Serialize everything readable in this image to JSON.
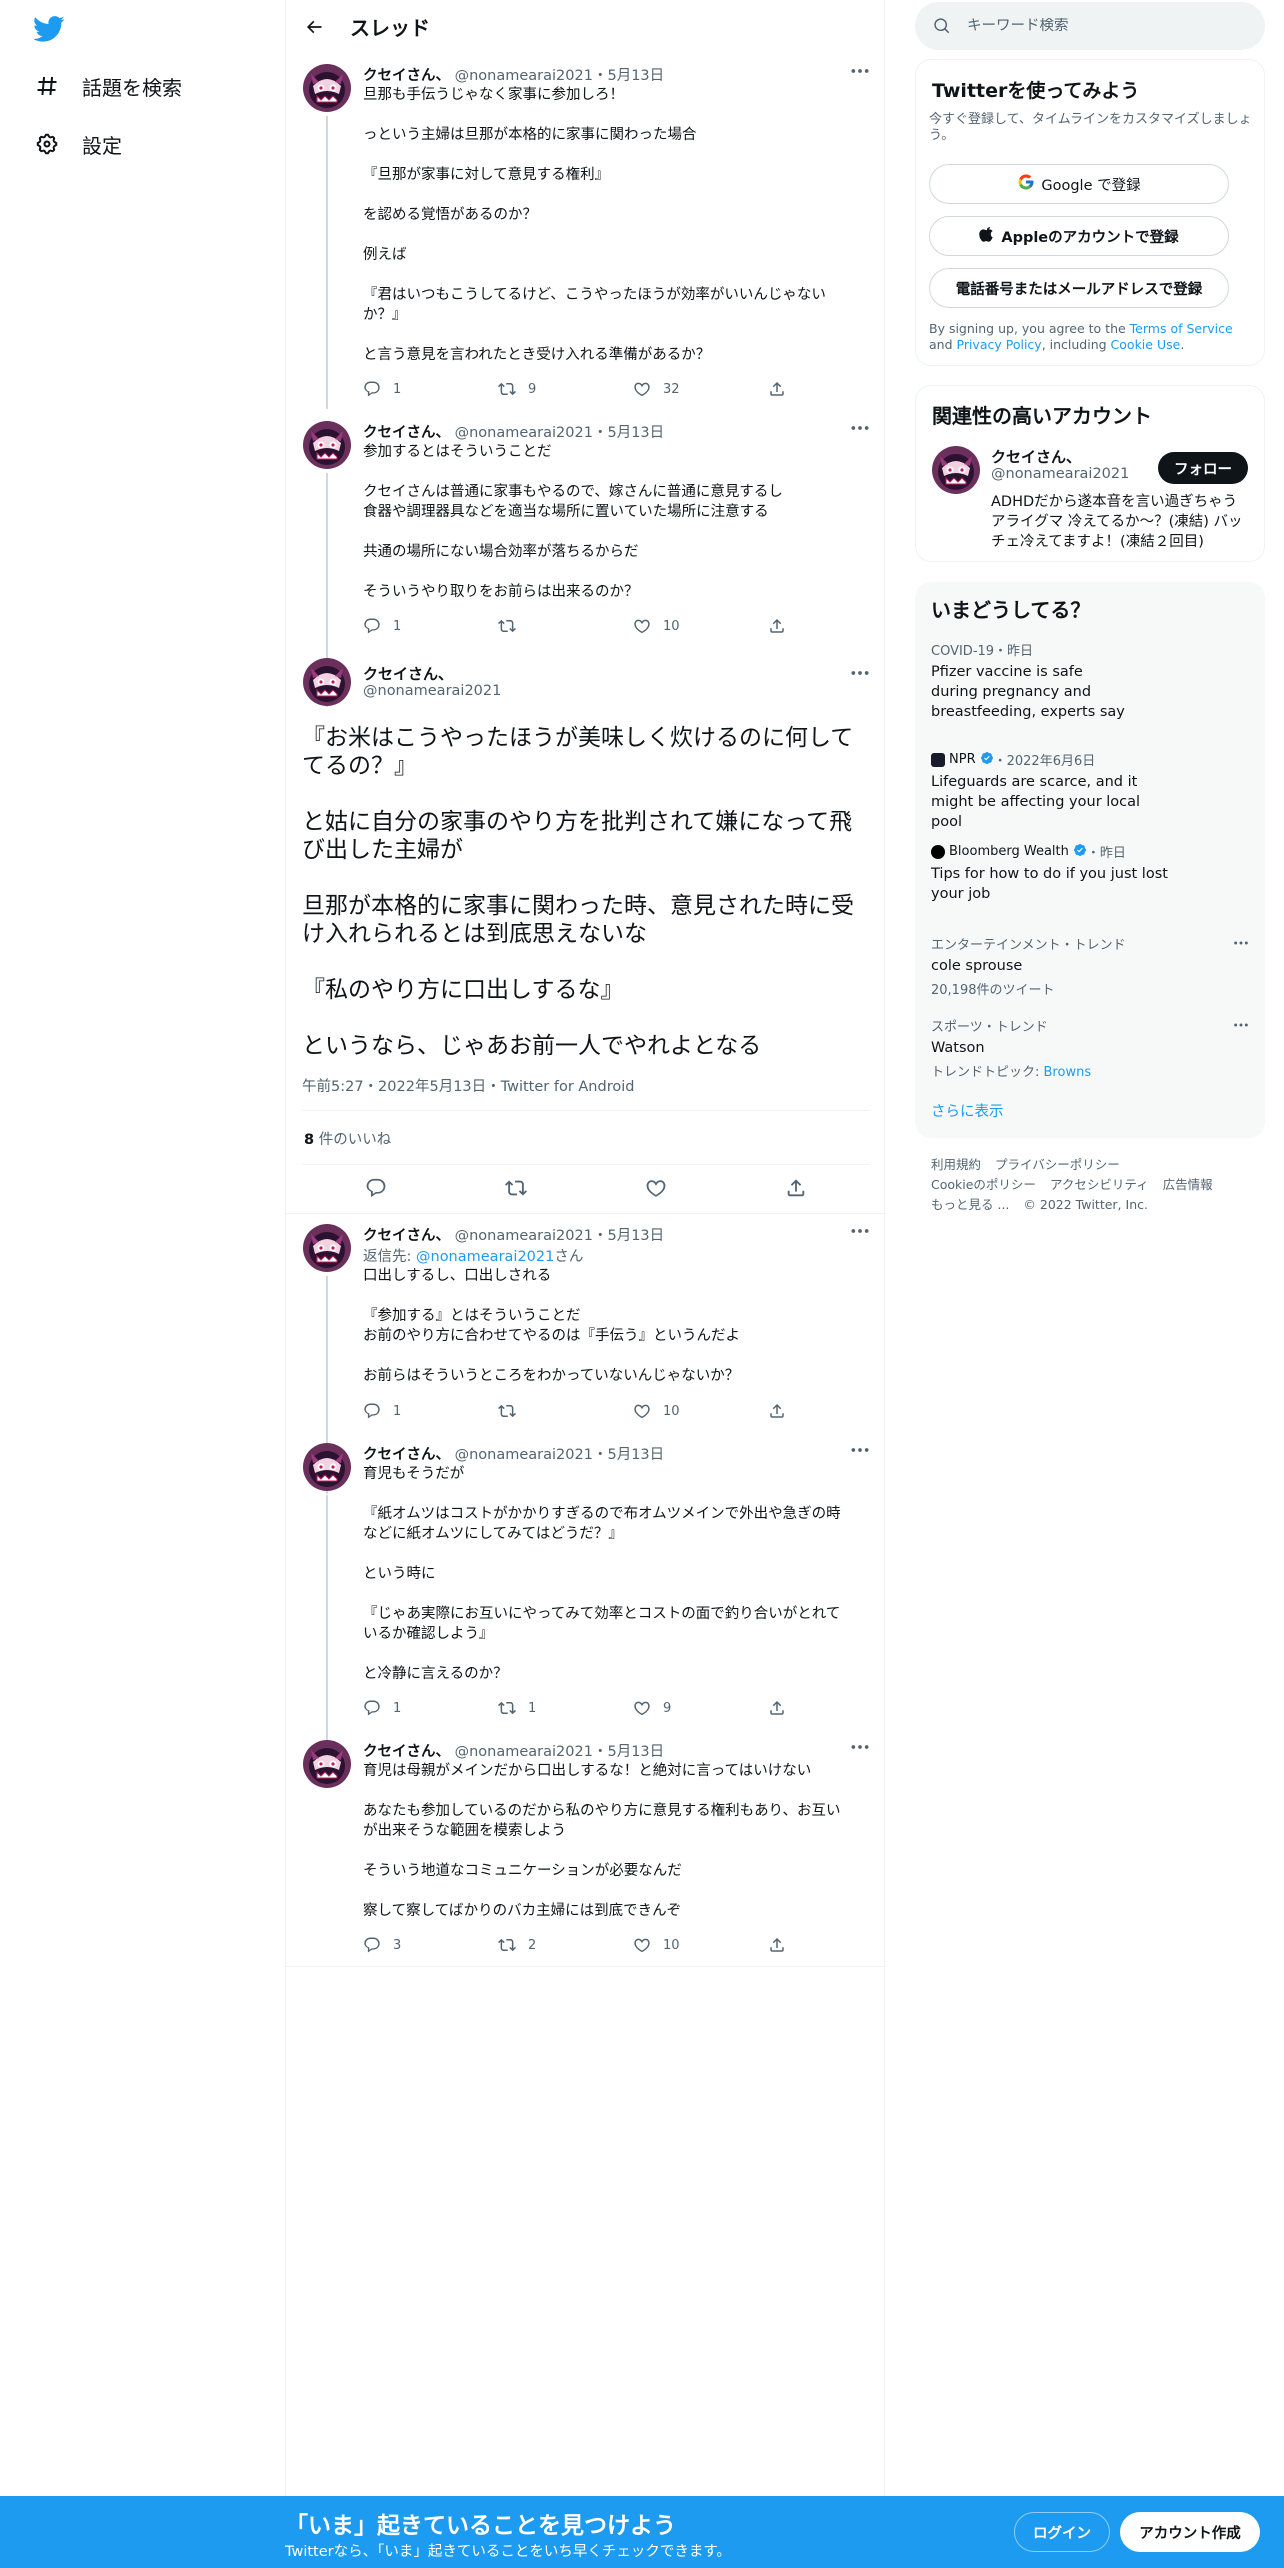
{
  "nav": {
    "explore_label": "話題を検索",
    "settings_label": "設定"
  },
  "header": {
    "title": "スレッド"
  },
  "tweets": [
    {
      "name": "クセイさん、",
      "handle": "@nonamearai2021",
      "sep": "・",
      "date": "5月13日",
      "lines": [
        "旦那も手伝うじゃなく家事に参加しろ！",
        "",
        "っという主婦は旦那が本格的に家事に関わった場合",
        "",
        "『旦那が家事に対して意見する権利』",
        "",
        "を認める覚悟があるのか？",
        "",
        "例えば",
        "",
        "『君はいつもこうしてるけど、こうやったほうが効率がいいんじゃない",
        "か？』",
        "",
        "と言う意見を言われたとき受け入れる準備があるか？"
      ],
      "replies": "1",
      "retweets": "9",
      "likes": "32"
    },
    {
      "name": "クセイさん、",
      "handle": "@nonamearai2021",
      "sep": "・",
      "date": "5月13日",
      "lines": [
        "参加するとはそういうことだ",
        "",
        "クセイさんは普通に家事もやるので、嫁さんに普通に意見するし",
        "食器や調理器具などを適当な場所に置いていた場所に注意する",
        "",
        "共通の場所にない場合効率が落ちるからだ",
        "",
        "そういうやり取りをお前らは出来るのか？"
      ],
      "replies": "1",
      "retweets": "",
      "likes": "10"
    },
    {
      "name": "クセイさん、",
      "handle": "@nonamearai2021",
      "sep": "・",
      "date": "5月13日",
      "reply_prefix": "返信先: ",
      "reply_handle": "@nonamearai2021",
      "reply_suffix": "さん",
      "lines": [
        "口出しするし、口出しされる",
        "",
        "『参加する』とはそういうことだ",
        "お前のやり方に合わせてやるのは『手伝う』というんだよ",
        "",
        "お前らはそういうところをわかっていないんじゃないか？"
      ],
      "replies": "1",
      "retweets": "",
      "likes": "10"
    },
    {
      "name": "クセイさん、",
      "handle": "@nonamearai2021",
      "sep": "・",
      "date": "5月13日",
      "lines": [
        "育児もそうだが",
        "",
        "『紙オムツはコストがかかりすぎるので布オムツメインで外出や急ぎの時",
        "などに紙オムツにしてみてはどうだ？』",
        "",
        "という時に",
        "",
        "『じゃあ実際にお互いにやってみて効率とコストの面で釣り合いがとれて",
        "いるか確認しよう』",
        "",
        "と冷静に言えるのか？"
      ],
      "replies": "1",
      "retweets": "1",
      "likes": "9"
    },
    {
      "name": "クセイさん、",
      "handle": "@nonamearai2021",
      "sep": "・",
      "date": "5月13日",
      "lines": [
        "育児は母親がメインだから口出しするな！と絶対に言ってはいけない",
        "",
        "あなたも参加しているのだから私のやり方に意見する権利もあり、お互い",
        "が出来そうな範囲を模索しよう",
        "",
        "そういう地道なコミュニケーションが必要なんだ",
        "",
        "察して察してばかりのバカ主婦には到底できんぞ"
      ],
      "replies": "3",
      "retweets": "2",
      "likes": "10"
    }
  ],
  "focal": {
    "name": "クセイさん、",
    "handle": "@nonamearai2021",
    "lines": [
      "『お米はこうやったほうが美味しく炊けるのに何して",
      "てるの？』",
      "",
      "と姑に自分の家事のやり方を批判されて嫌になって飛",
      "び出した主婦が",
      "",
      "旦那が本格的に家事に関わった時、意見された時に受",
      "け入れられるとは到底思えないな",
      "",
      "『私のやり方に口出しするな』",
      "",
      "というなら、じゃあお前一人でやれよとなる"
    ],
    "meta": "午前5:27・2022年5月13日・Twitter for Android",
    "like_count": "8",
    "like_label": " 件のいいね"
  },
  "search": {
    "placeholder": "キーワード検索"
  },
  "signup": {
    "title": "Twitterを使ってみよう",
    "subtitle": "今すぐ登録して、タイムラインをカスタマイズしましょう。",
    "google_label": "Google で登録",
    "apple_label": "Appleのアカウントで登録",
    "phone_label": "電話番号またはメールアドレスで登録",
    "legal_1": "By signing up, you agree to the ",
    "legal_tos": "Terms of Service",
    "legal_2": " and ",
    "legal_privacy": "Privacy Policy",
    "legal_3": ", including ",
    "legal_cookie": "Cookie Use",
    "legal_4": "."
  },
  "related": {
    "title": "関連性の高いアカウント",
    "name": "クセイさん、",
    "handle": "@nonamearai2021",
    "follow_label": "フォロー",
    "bio": "ADHDだから遂本音を言い過ぎちゃうアライグマ 冷えてるか～？(凍結) バッチェ冷えてますよ！(凍結２回目)"
  },
  "trends": {
    "title": "いまどうしてる？",
    "items": [
      {
        "context": "COVID-19・昨日",
        "title": "Pfizer vaccine is safe during pregnancy and breastfeeding, experts say"
      },
      {
        "source": "NPR",
        "time": "・2022年6月6日",
        "title": "Lifeguards are scarce, and it might be affecting your local pool"
      },
      {
        "source": "Bloomberg Wealth",
        "time": "・昨日",
        "title": "Tips for how to do if you just lost your job"
      },
      {
        "context": "エンターテインメント・トレンド",
        "title": "cole sprouse",
        "count": "20,198件のツイート"
      },
      {
        "context": "スポーツ・トレンド",
        "title": "Watson",
        "count_prefix": "トレンドトピック: ",
        "count_link": "Browns"
      }
    ],
    "show_more": "さらに表示"
  },
  "footer": {
    "links": [
      "利用規約",
      "プライバシーポリシー",
      "Cookieのポリシー",
      "アクセシビリティ",
      "広告情報",
      "もっと見る ...",
      "© 2022 Twitter, Inc."
    ]
  },
  "banner": {
    "title": "「いま」起きていることを見つけよう",
    "subtitle": "Twitterなら、「いま」起きていることをいち早くチェックできます。",
    "login_label": "ログイン",
    "signup_label": "アカウント作成"
  },
  "colors": {
    "accent": "#1d9bf0",
    "text": "#0f1419",
    "muted": "#536471",
    "border": "#eff3f4"
  }
}
